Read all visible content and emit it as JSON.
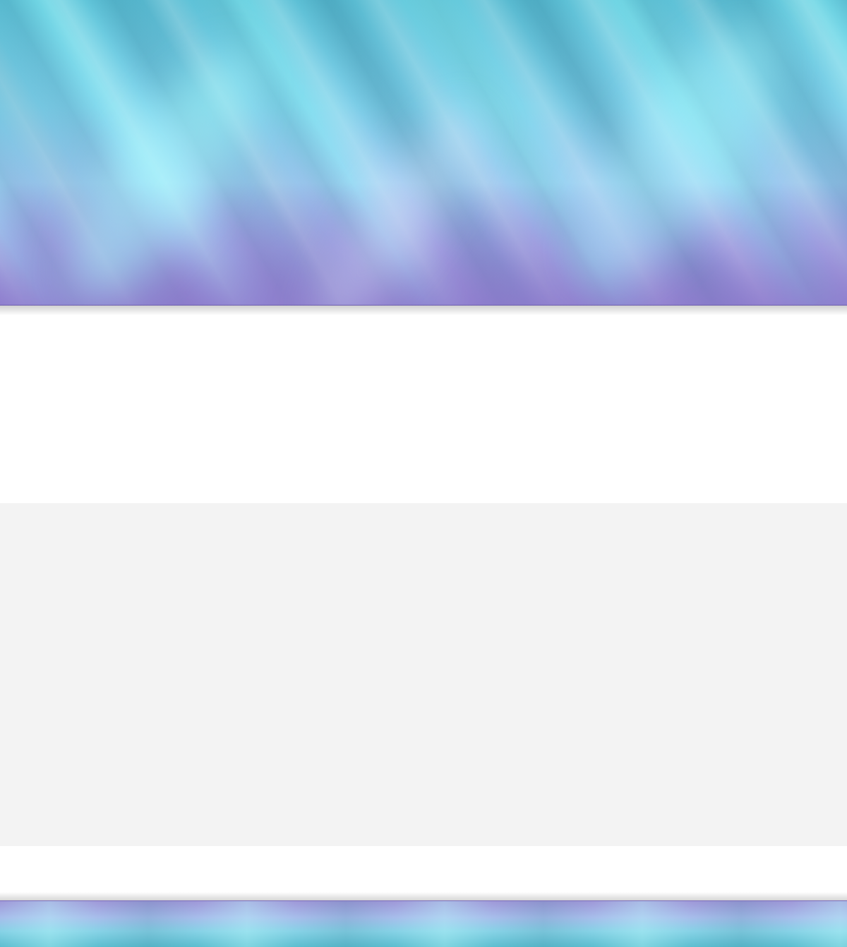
{
  "colors": {
    "header_top": "#5fc3d8",
    "header_bottom": "#9b93d3",
    "content_band": "#ffffff",
    "grey_section": "#f3f3f3",
    "footer_top": "#9f98d8",
    "footer_bottom": "#5bbdcf"
  }
}
